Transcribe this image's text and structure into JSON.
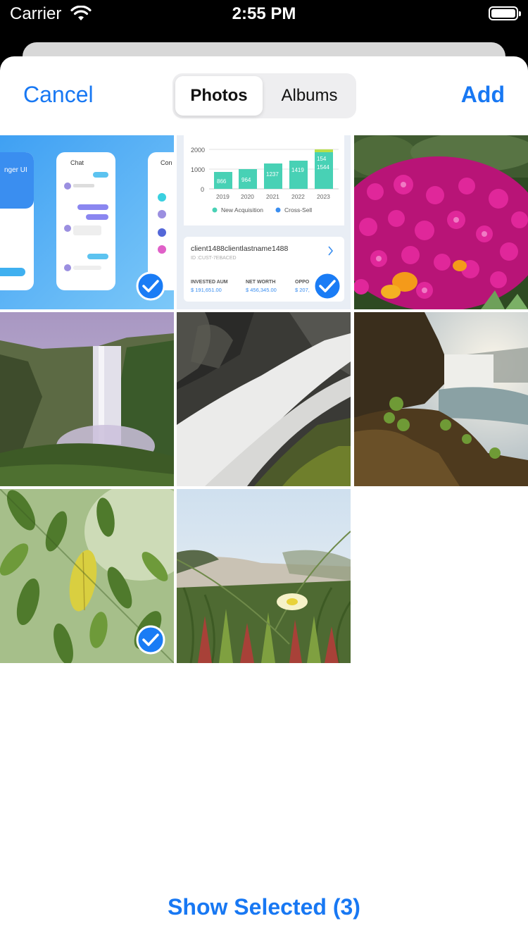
{
  "status_bar": {
    "carrier": "Carrier",
    "time": "2:55 PM",
    "wifi_icon": "wifi-icon",
    "battery_icon": "battery-icon"
  },
  "nav": {
    "cancel_label": "Cancel",
    "add_label": "Add",
    "segments": [
      {
        "label": "Photos",
        "selected": true
      },
      {
        "label": "Albums",
        "selected": false
      }
    ]
  },
  "photos": [
    {
      "subject": "messenger-ui-mockup",
      "selected": true
    },
    {
      "subject": "finance-dashboard-screenshot",
      "selected": true
    },
    {
      "subject": "magenta-flowers",
      "selected": false
    },
    {
      "subject": "waterfall-misty-valley",
      "selected": false
    },
    {
      "subject": "waterfall-long-exposure",
      "selected": false
    },
    {
      "subject": "waterfall-sunlit",
      "selected": false
    },
    {
      "subject": "green-leaves",
      "selected": true
    },
    {
      "subject": "beach-grass-flower",
      "selected": false
    }
  ],
  "screenshot_text": {
    "chat_title": "Chat",
    "contacts_title": "Con",
    "ui_title": "nger UI",
    "chart_years": [
      "2019",
      "2020",
      "2021",
      "2022",
      "2023"
    ],
    "chart_values": [
      "866",
      "964",
      "1237",
      "1419",
      "1544"
    ],
    "chart_top_value": "154",
    "axis_ticks": [
      "2000",
      "1000",
      "0"
    ],
    "legend_a": "New Acquisition",
    "legend_b": "Cross-Sell",
    "client_name": "client1488clientlastname1488",
    "client_id": "ID :CUST-7EBACED",
    "col_a": "INVESTED AUM",
    "col_b": "NET WORTH",
    "col_c": "OPPO",
    "val_a": "$ 191,651.00",
    "val_b": "$ 456,345.00",
    "val_c": "$ 207,"
  },
  "footer": {
    "show_selected_label": "Show Selected (3)"
  },
  "colors": {
    "accent": "#1878f3",
    "check_fill": "#1a7cf5"
  }
}
